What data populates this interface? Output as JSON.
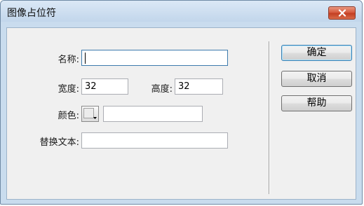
{
  "window": {
    "title": "图像占位符"
  },
  "labels": {
    "name": "名称:",
    "width": "宽度:",
    "height": "高度:",
    "color": "颜色:",
    "alt_text": "替换文本:"
  },
  "fields": {
    "name": "",
    "width": "32",
    "height": "32",
    "color_hex": "",
    "alt_text": ""
  },
  "buttons": {
    "ok": "确定",
    "cancel": "取消",
    "help": "帮助"
  },
  "icons": {
    "close": "close-icon",
    "swatch_arrow": "triangle-down-icon"
  }
}
